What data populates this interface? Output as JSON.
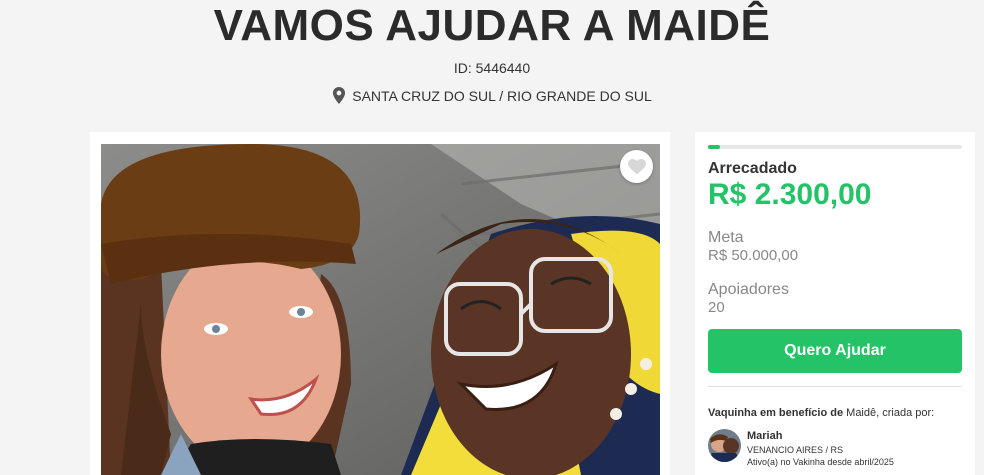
{
  "campaign": {
    "title": "VAMOS AJUDAR A MAIDÊ",
    "id_label": "ID: 5446440",
    "location": "SANTA CRUZ DO SUL / RIO GRANDE DO SUL"
  },
  "stats": {
    "progress_percent": 4.6,
    "raised_label": "Arrecadado",
    "raised_value": "R$ 2.300,00",
    "goal_label": "Meta",
    "goal_value": "R$ 50.000,00",
    "supporters_label": "Apoiadores",
    "supporters_value": "20"
  },
  "cta": {
    "label": "Quero Ajudar"
  },
  "beneficiary": {
    "prefix": "Vaquinha em benefício de",
    "name": "Maidê",
    "suffix": ", criada por:"
  },
  "creator": {
    "name": "Mariah",
    "location": "VENANCIO AIRES / RS",
    "since": "Ativo(a) no Vakinha desde abril/2025"
  },
  "icons": {
    "location": "map-pin-icon",
    "favorite": "heart-icon"
  },
  "colors": {
    "accent": "#24c367",
    "title": "#2b2b2b",
    "muted": "#888888"
  }
}
